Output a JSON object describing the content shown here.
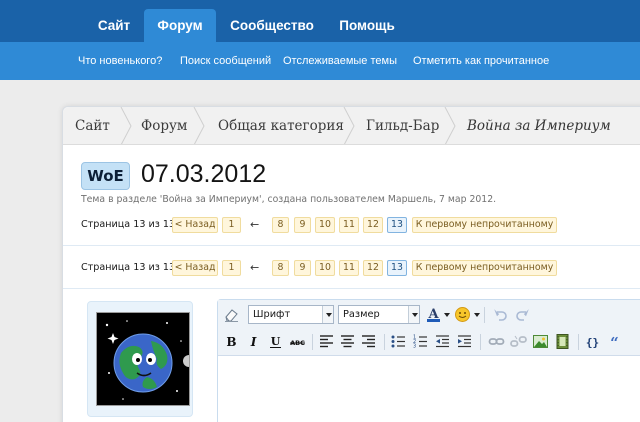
{
  "nav": {
    "tabs": [
      {
        "label": "Сайт"
      },
      {
        "label": "Форум",
        "active": true
      },
      {
        "label": "Сообщество"
      },
      {
        "label": "Помощь"
      }
    ],
    "sublinks": [
      {
        "label": "Что новенького?"
      },
      {
        "label": "Поиск сообщений"
      },
      {
        "label": "Отслеживаемые темы"
      },
      {
        "label": "Отметить как прочитанное"
      }
    ]
  },
  "breadcrumbs": [
    {
      "label": "Сайт"
    },
    {
      "label": "Форум"
    },
    {
      "label": "Общая категория"
    },
    {
      "label": "Гильд-Бар"
    },
    {
      "label": "Война за Империум",
      "current": true
    }
  ],
  "thread": {
    "prefix": "WoE",
    "title": "07.03.2012",
    "meta": "Тема в разделе 'Война за Империум', создана пользователем Маршель, 7 мар 2012."
  },
  "pagination": {
    "label": "Страница 13 из 13",
    "prev_label": "< Назад",
    "first_page": "1",
    "arrow": "←",
    "pages": [
      "8",
      "9",
      "10",
      "11",
      "12",
      "13"
    ],
    "current_page": "13",
    "first_unread_label": "К первому непрочитанному"
  },
  "editor": {
    "font_label": "Шрифт",
    "size_label": "Размер"
  },
  "colors": {
    "nav_dark": "#1a62a8",
    "nav_light": "#2f8ad6",
    "page_button_bg": "#fff6dc",
    "page_button_border": "#f0dc9e",
    "current_page_border": "#82b4e0"
  }
}
